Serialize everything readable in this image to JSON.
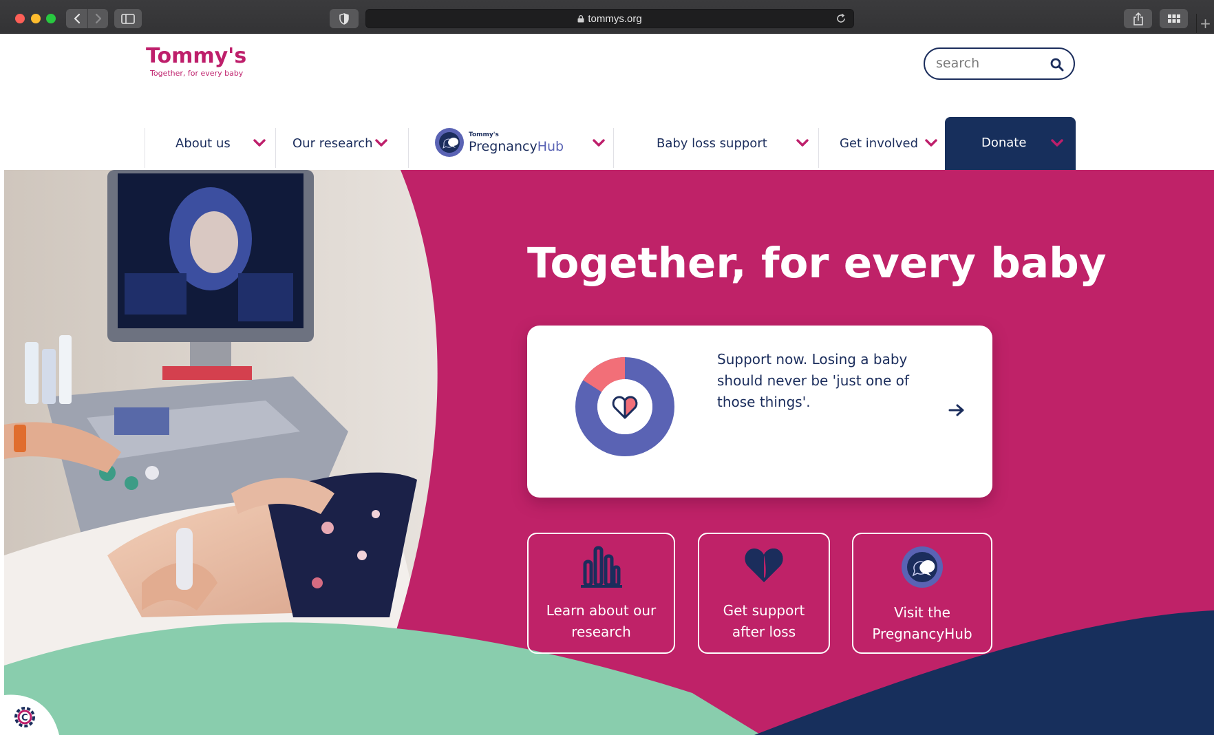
{
  "browser": {
    "url": "tommys.org"
  },
  "site": {
    "logo_name": "Tommy's",
    "logo_tagline": "Together, for every baby",
    "search_placeholder": "search"
  },
  "nav": {
    "items": [
      {
        "label": "About us"
      },
      {
        "label": "Our research"
      },
      {
        "label": "Baby loss support"
      },
      {
        "label": "Get involved"
      }
    ],
    "hub_small": "Tommy's",
    "hub_word_a": "Pregnancy",
    "hub_word_b": "Hub",
    "donate_label": "Donate"
  },
  "hero": {
    "headline": "Together, for every baby",
    "card_text": "Support now. Losing a baby should never be 'just one of those things'.",
    "donut_highlight_fraction": 0.16,
    "tiles": [
      {
        "line1": "Learn about our",
        "line2": "research"
      },
      {
        "line1": "Get support",
        "line2": "after loss"
      },
      {
        "line1": "Visit the",
        "line2": "PregnancyHub"
      }
    ]
  },
  "colors": {
    "brand_pink": "#be1f6b",
    "navy": "#172f5c",
    "hub_purple": "#5a63b4",
    "mint": "#89cdad",
    "coral": "#f26f78"
  },
  "icons": {
    "search": "search-icon",
    "chevron": "chevron-down-icon",
    "arrow": "arrow-right-icon",
    "research": "bar-chart-icon",
    "support": "heart-icon",
    "hub": "chat-bubbles-icon",
    "cookie": "cookie-settings-icon"
  }
}
